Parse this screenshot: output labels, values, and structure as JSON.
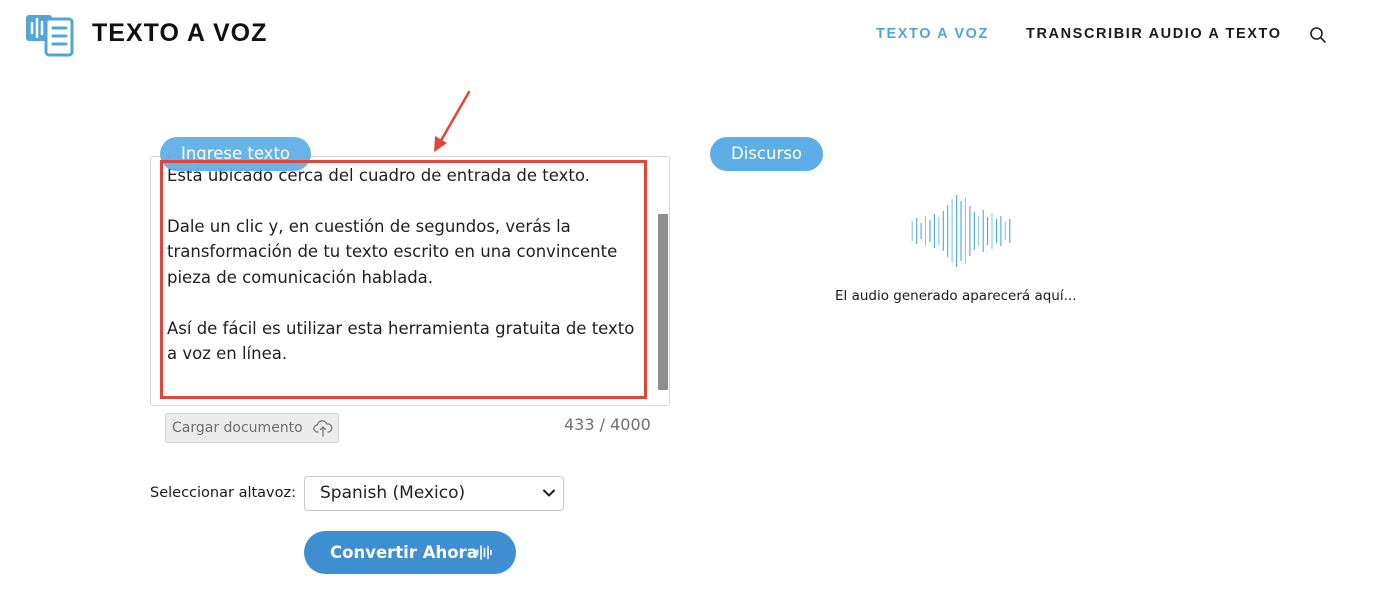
{
  "header": {
    "brand": "TEXTO A VOZ",
    "nav": [
      "TEXTO A VOZ",
      "TRANSCRIBIR AUDIO A TEXTO"
    ],
    "search_icon": "search-icon",
    "accent_color": "#4ea6d9"
  },
  "input_panel": {
    "label": "Ingrese texto",
    "text": "presione sobre el botón “Convertir ahora” en el sitio web. Está ubicado cerca del cuadro de entrada de texto.\n\nDale un clic y, en cuestión de segundos, verás la transformación de tu texto escrito en una convincente pieza de comunicación hablada.\n\nAsí de fácil es utilizar esta herramienta gratuita de texto a voz en línea.",
    "upload_label": "Cargar documento",
    "upload_icon": "cloud-upload-icon",
    "char_count": "433 / 4000"
  },
  "speech_panel": {
    "label": "Discurso",
    "placeholder": "El audio generado aparecerá aquí...",
    "waveform_icon": "waveform-icon"
  },
  "voice": {
    "label": "Seleccionar altavoz:",
    "selected": "Spanish (Mexico)"
  },
  "convert": {
    "label": "Convertir Ahora",
    "button_color": "#3e8fd1"
  },
  "annotation": {
    "highlight_color": "#e0463a"
  }
}
